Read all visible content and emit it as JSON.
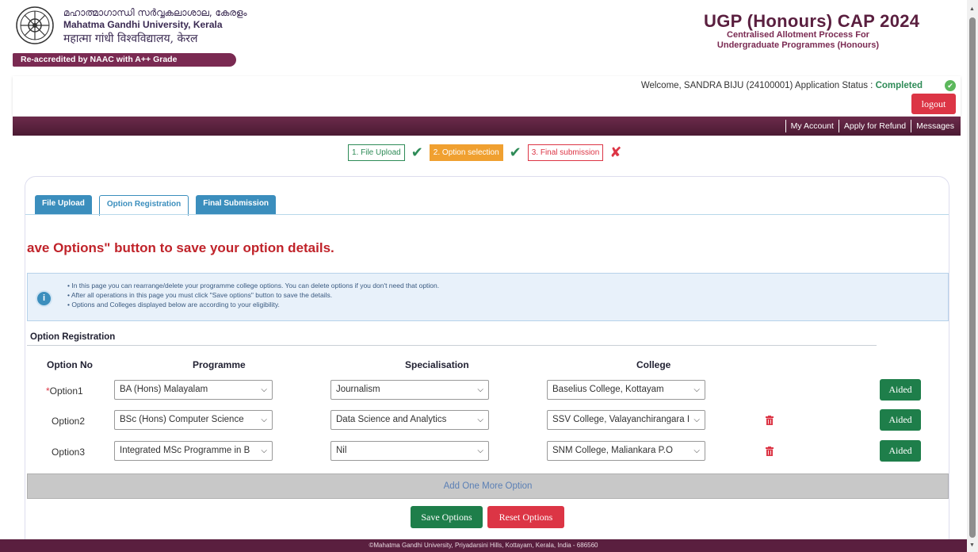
{
  "header": {
    "uni_name_ml": "മഹാത്മാഗാന്ധി സർവ്വകലാശാല, കേരളം",
    "uni_name_en": "Mahatma Gandhi University, Kerala",
    "uni_name_hi": "महात्मा गांधी विश्वविद्यालय, केरल",
    "accreditation": "Re-accredited by NAAC with A++ Grade",
    "cap_title": "UGP (Honours) CAP 2024",
    "cap_subtitle_1": "Centralised Allotment Process For",
    "cap_subtitle_2": "Undergraduate Programmes (Honours)"
  },
  "user": {
    "welcome_prefix": "Welcome, SANDRA BIJU (24100001)  Application Status : ",
    "status": "Completed",
    "logout_label": "logout"
  },
  "nav": {
    "links": [
      "My Account",
      "Apply for Refund",
      "Messages"
    ]
  },
  "steps": [
    {
      "label": "1. File Upload",
      "state": "done"
    },
    {
      "label": "2. Option selection",
      "state": "done"
    },
    {
      "label": "3. Final submission",
      "state": "pending"
    }
  ],
  "tabs": [
    {
      "label": "File Upload"
    },
    {
      "label": "Option Registration"
    },
    {
      "label": "Final Submission"
    }
  ],
  "marquee_text": "ave Options\" button to save your option details.",
  "info": {
    "lines": [
      "In this page you can rearrange/delete your programme college options. You can delete options if you don't need that option.",
      "After all operations in this page you must click \"Save options\" button to save the details.",
      "Options and Colleges displayed below are according to your eligibility."
    ]
  },
  "section": {
    "title": "Option Registration",
    "columns": {
      "option_no": "Option No",
      "programme": "Programme",
      "specialisation": "Specialisation",
      "college": "College"
    }
  },
  "options": [
    {
      "label": "Option1",
      "required_mark": "*",
      "programme": "BA (Hons) Malayalam",
      "specialisation": "Journalism",
      "college": "Baselius College, Kottayam",
      "type": "Aided"
    },
    {
      "label": "Option2",
      "required_mark": "",
      "programme": "BSc (Hons) Computer Science",
      "specialisation": "Data Science and Analytics",
      "college": "SSV College, Valayanchirangara I",
      "type": "Aided"
    },
    {
      "label": "Option3",
      "required_mark": "",
      "programme": "Integrated MSc Programme in B",
      "specialisation": "Nil",
      "college": "SNM College, Maliankara P.O",
      "type": "Aided"
    }
  ],
  "actions": {
    "add_more": "Add One More Option",
    "save": "Save Options",
    "reset": "Reset Options"
  },
  "footer": "©Mahatma Gandhi University, Priyadarsini Hills, Kottayam, Kerala, India - 686560",
  "colors": {
    "brand": "#5a1f3f",
    "success": "#1e7e4a",
    "danger": "#dc3545",
    "tab": "#3b8ebd",
    "step_active": "#f0a030"
  }
}
